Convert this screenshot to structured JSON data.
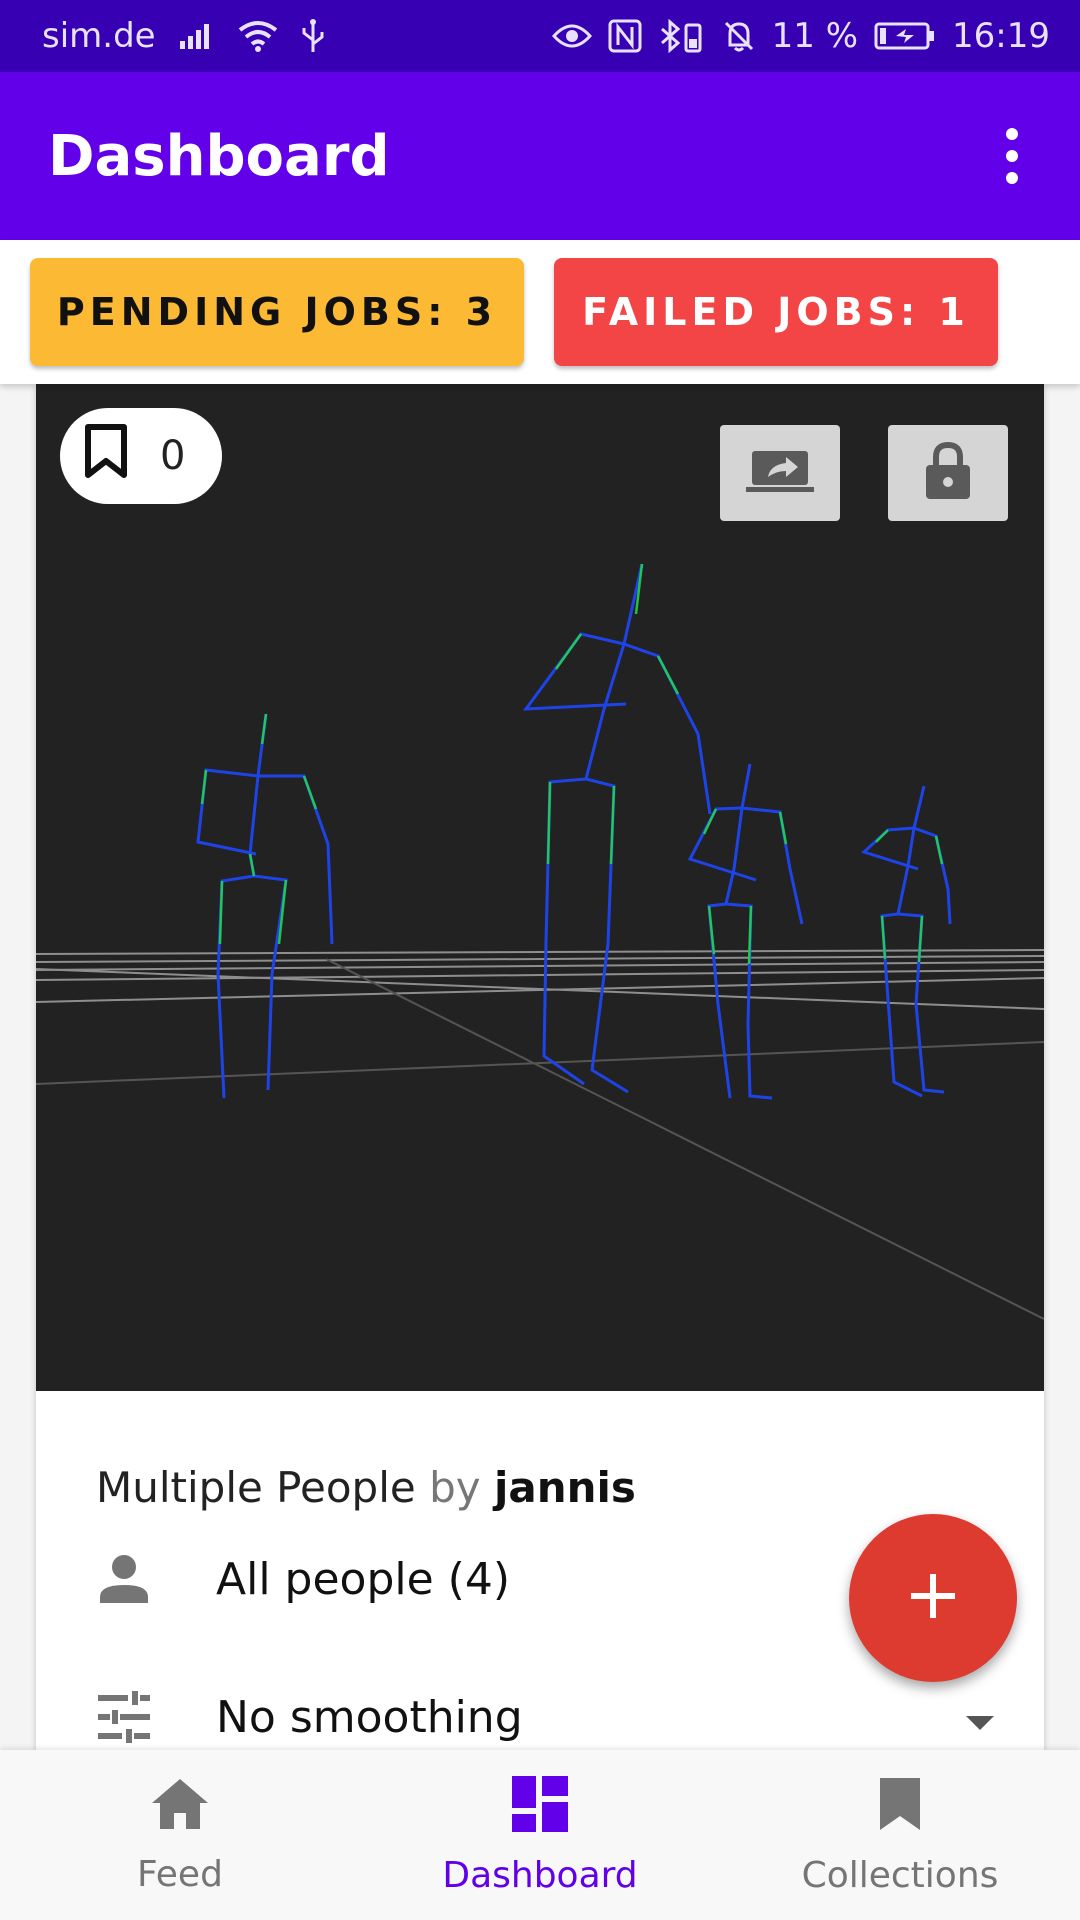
{
  "status_bar": {
    "carrier": "sim.de",
    "battery": "11 %",
    "time": "16:19"
  },
  "app_bar": {
    "title": "Dashboard",
    "menu_icon": "more-vert-icon"
  },
  "jobs": {
    "pending_label": "PENDING JOBS: 3",
    "failed_label": "FAILED JOBS: 1"
  },
  "card": {
    "bookmark_count": "0",
    "share_icon": "share-screen-icon",
    "lock_icon": "lock-icon",
    "title": "Multiple People",
    "by": "by",
    "author": "jannis",
    "people_label": "All people (4)",
    "smoothing_label": "No smoothing"
  },
  "colors": {
    "primary": "#6200ea",
    "status_bar": "#3700b3",
    "pending": "#fbb934",
    "failed": "#f44546",
    "fab": "#dd3b30",
    "viewer_bg": "#222222"
  },
  "bottom_nav": {
    "items": [
      {
        "label": "Feed",
        "icon": "home-icon"
      },
      {
        "label": "Dashboard",
        "icon": "dashboard-icon"
      },
      {
        "label": "Collections",
        "icon": "bookmark-icon"
      }
    ],
    "active": "Dashboard"
  }
}
